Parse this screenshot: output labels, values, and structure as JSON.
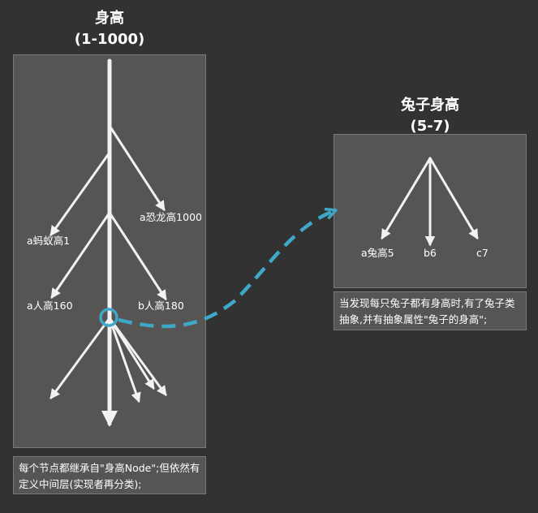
{
  "left": {
    "title": "身高",
    "range": "(1-1000)",
    "nodes": {
      "ant": "a蚂蚁高1",
      "dino": "a恐龙高1000",
      "human_a": "a人高160",
      "human_b": "b人高180"
    },
    "note": "每个节点都继承自\"身高Node\";但依然有定义中间层(实现者再分类);"
  },
  "right": {
    "title": "兔子身高",
    "range": "(5-7)",
    "nodes": {
      "a": "a兔高5",
      "b": "b6",
      "c": "c7"
    },
    "note": "当发现每只兔子都有身高时,有了兔子类抽象,并有抽象属性\"兔子的身高\";"
  },
  "colors": {
    "background": "#323232",
    "panel": "#575454",
    "arrow": "#f2f2f2",
    "highlight": "#3ea8c8"
  }
}
